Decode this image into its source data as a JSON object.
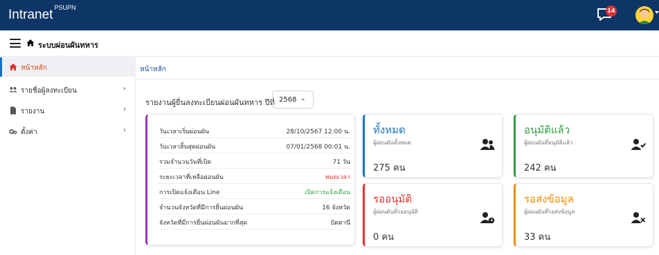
{
  "header": {
    "brand": "Intranet",
    "brand_sup": "PSUPN",
    "notification_count": "14"
  },
  "subbar": {
    "title": "ระบบผ่อนผันทหาร"
  },
  "sidebar": {
    "items": [
      {
        "label": "หน้าหลัก"
      },
      {
        "label": "รายชื่อผู้ลงทะเบียน"
      },
      {
        "label": "รายงาน"
      },
      {
        "label": "ตั้งค่า"
      }
    ]
  },
  "breadcrumb": "หน้าหลัก",
  "report": {
    "label": "รายงานผู้ยื่นลงทะเบียนผ่อนผันทหาร ปีที่",
    "year": "2568"
  },
  "info": [
    {
      "key": "วันเวลาเริ่มผ่อนผัน",
      "value": "28/10/2567 12:00 น."
    },
    {
      "key": "วันเวลาสิ้นสุดผ่อนผัน",
      "value": "07/01/2568 00:01 น."
    },
    {
      "key": "รวมจำนวนวันที่เปิด",
      "value": "71 วัน"
    },
    {
      "key": "ระยะเวลาที่เหลือผ่อนผัน",
      "value": "หมดเวลา"
    },
    {
      "key": "การเปิดแจ้งเตือน Line",
      "value": "เปิดการแจ้งเตือน"
    },
    {
      "key": "จำนวนจังหวัดที่มีการยื่นผ่อนผัน",
      "value": "16 จังหวัด"
    },
    {
      "key": "จังหวัดที่มีการยื่นผ่อนผันมากที่สุด",
      "value": "ปัตตานี"
    }
  ],
  "stats": [
    {
      "title": "ทั้งหมด",
      "sub": "ผู้ผ่อนผันทั้งหมด",
      "count": "275 คน",
      "color": "#1971c2",
      "icon": "users-icon"
    },
    {
      "title": "อนุมัติแล้ว",
      "sub": "ผู้ผ่อนผันที่อนุมัติแล้ว",
      "count": "242 คน",
      "color": "#2f9e44",
      "icon": "user-check-icon"
    },
    {
      "title": "รออนุมัติ",
      "sub": "ผู้ผ่อนผันที่รออนุมัติ",
      "count": "0 คน",
      "color": "#e03131",
      "icon": "user-clock-icon"
    },
    {
      "title": "รอส่งข้อมูล",
      "sub": "ผู้ผ่อนผันที่รอส่งข้อมูล",
      "count": "33 คน",
      "color": "#f08c00",
      "icon": "user-xmark-icon"
    }
  ]
}
